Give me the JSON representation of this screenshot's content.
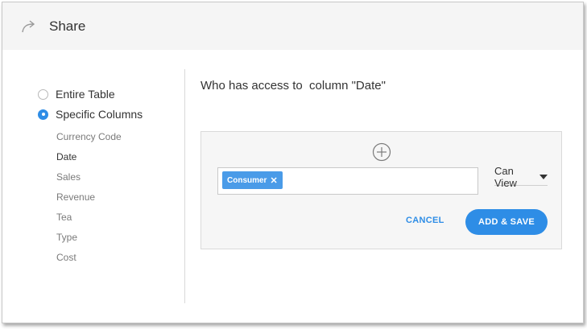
{
  "header": {
    "title": "Share",
    "icon": "share-arrow-icon"
  },
  "sidebar": {
    "options": [
      {
        "label": "Entire Table",
        "checked": false
      },
      {
        "label": "Specific Columns",
        "checked": true
      }
    ],
    "columns": [
      "Currency Code",
      "Date",
      "Sales",
      "Revenue",
      "Tea",
      "Type",
      "Cost"
    ],
    "selected_column": "Date"
  },
  "main": {
    "title": "Who has access to  column \"Date\""
  },
  "panel": {
    "add_icon": "plus-circle-icon",
    "chips": [
      {
        "label": "Consumer",
        "remove_icon": "close-icon"
      }
    ],
    "permission": "Can View",
    "cancel_label": "CANCEL",
    "save_label": "ADD & SAVE"
  },
  "colors": {
    "accent": "#2e8de6",
    "chip": "#4a9be8",
    "header_bg": "#f5f5f5",
    "panel_bg": "#f6f6f6"
  }
}
